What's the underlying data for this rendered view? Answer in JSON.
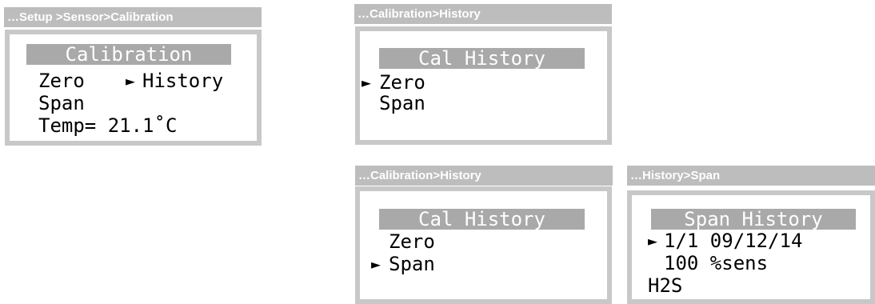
{
  "panels": {
    "calibration": {
      "breadcrumb": "…Setup >Sensor>Calibration",
      "title": "Calibration",
      "items": {
        "zero": "Zero",
        "history_cursor": "►",
        "history": "History",
        "span": "Span",
        "temp": "Temp= 21.1˚C"
      }
    },
    "cal_history_zero": {
      "breadcrumb": "…Calibration>History",
      "title": "Cal History",
      "items": {
        "zero_cursor": "►",
        "zero": "Zero",
        "span": "Span"
      }
    },
    "cal_history_span": {
      "breadcrumb": "…Calibration>History",
      "title": "Cal History",
      "items": {
        "zero": "Zero",
        "span_cursor": "►",
        "span": "Span"
      }
    },
    "span_history": {
      "breadcrumb": "…History>Span",
      "title": "Span History",
      "items": {
        "record_cursor": "►",
        "record": "1/1 09/12/14",
        "sensitivity": "100 %sens",
        "gas": "H2S"
      }
    }
  }
}
